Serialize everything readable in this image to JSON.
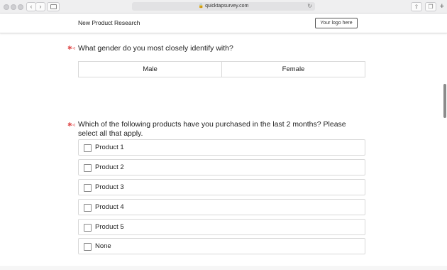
{
  "browser": {
    "url": "quicktapsurvey.com"
  },
  "header": {
    "survey_title": "New Product Research",
    "logo_text": "Your logo here"
  },
  "question1": {
    "text": "What gender do you most closely identify with?",
    "options": [
      "Male",
      "Female"
    ]
  },
  "question2": {
    "text_line1": "Which of the following products have you purchased in the last 2 months? Please",
    "text_line2": "select all that apply.",
    "options": [
      "Product 1",
      "Product 2",
      "Product 3",
      "Product 4",
      "Product 5",
      "None"
    ]
  },
  "icons": {
    "required": "required-audio-icon",
    "lock": "lock-icon",
    "reload": "reload-icon"
  }
}
